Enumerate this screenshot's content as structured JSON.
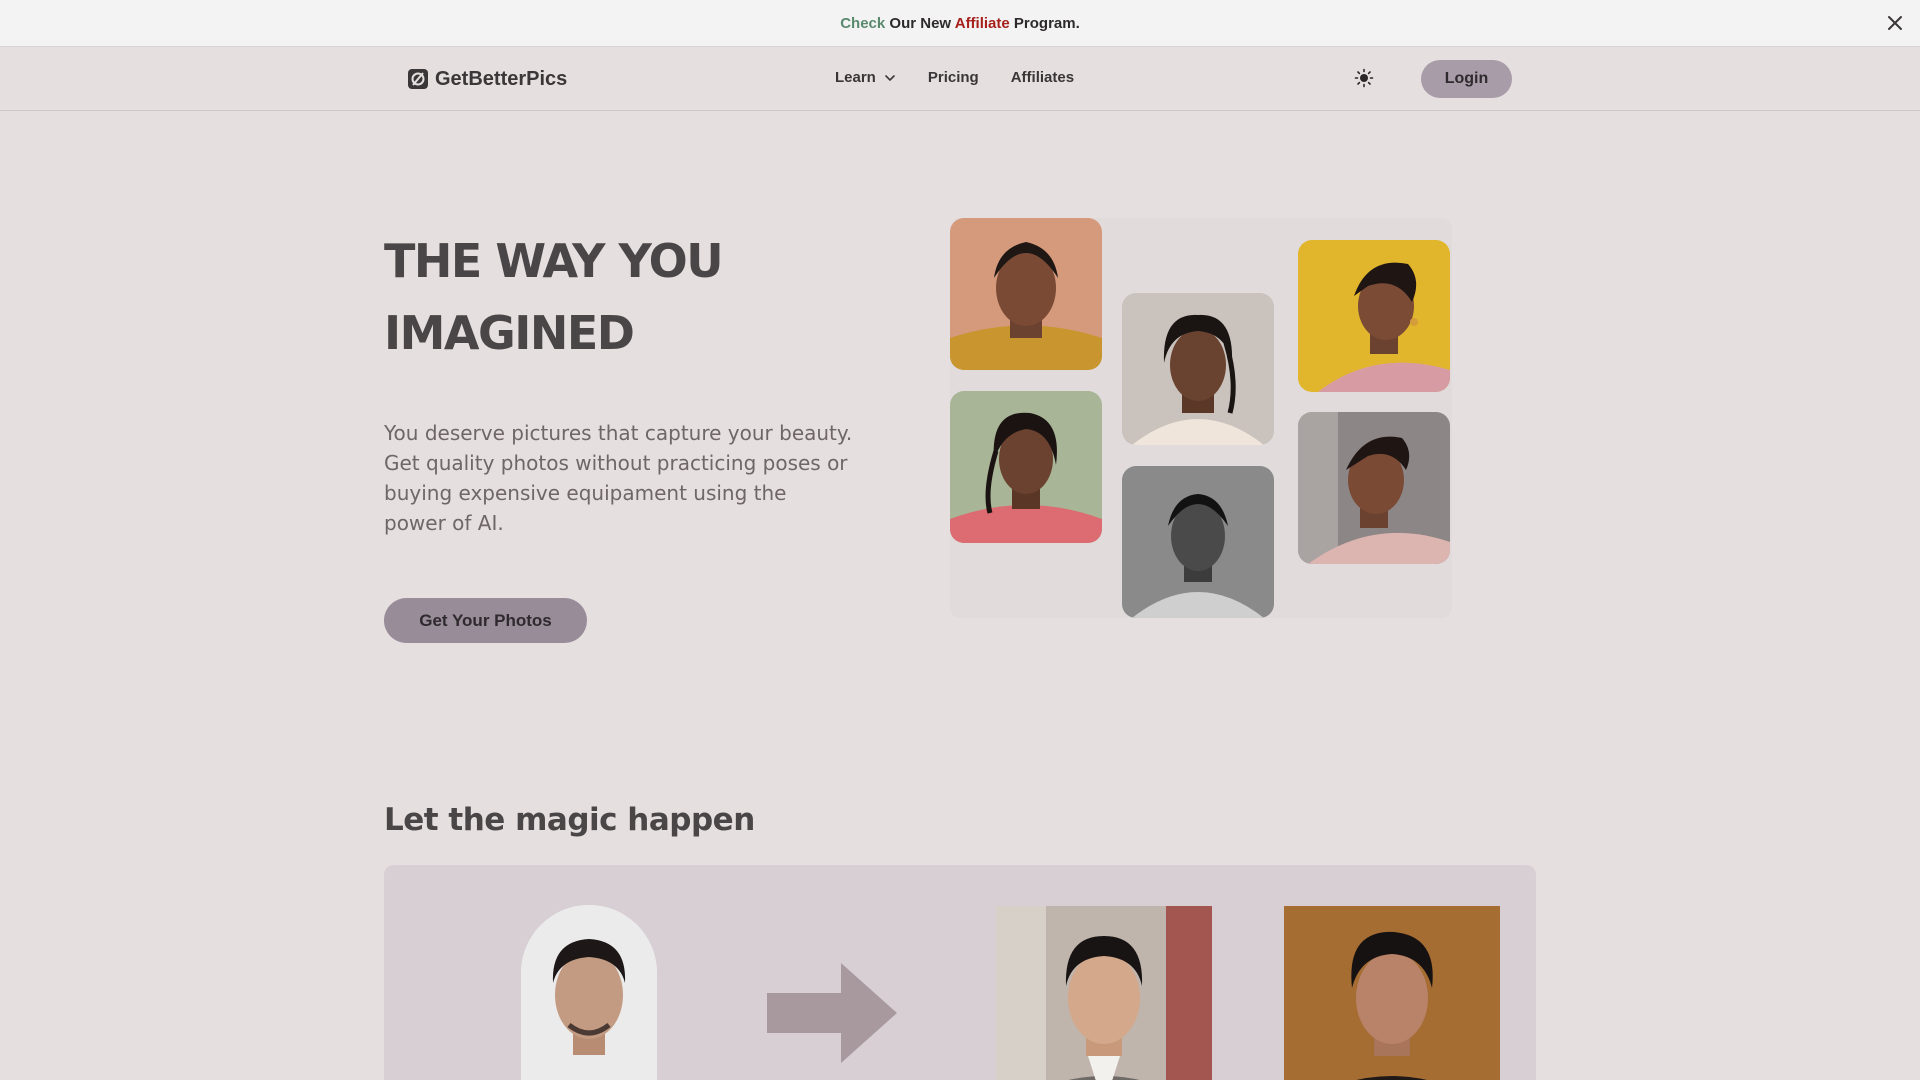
{
  "announcement": {
    "check": "Check",
    "middle": "Our New",
    "affiliate": "Affiliate",
    "end": "Program.",
    "close_icon": "close-icon"
  },
  "nav": {
    "brand": "GetBetterPics",
    "links": [
      {
        "label": "Learn",
        "has_dropdown": true
      },
      {
        "label": "Pricing"
      },
      {
        "label": "Affiliates"
      }
    ],
    "theme_icon": "sun-icon",
    "login_label": "Login"
  },
  "hero": {
    "title_line1": "THE WAY YOU",
    "title_line2": "IMAGINED",
    "subtitle": "You deserve pictures that capture your beauty. Get quality photos without practicing poses or buying expensive equipament using the power of AI.",
    "cta_label": "Get Your Photos"
  },
  "gallery": {
    "photos": [
      {
        "name": "portrait-woman-yellow-sweater"
      },
      {
        "name": "portrait-woman-beige-turtleneck"
      },
      {
        "name": "portrait-woman-pink-sweater-yellow-bg"
      },
      {
        "name": "portrait-woman-pink-sweater-green-bg"
      },
      {
        "name": "portrait-woman-black-and-white"
      },
      {
        "name": "portrait-woman-pink-sweater-street"
      }
    ]
  },
  "magic": {
    "title": "Let the magic happen",
    "arrow_icon": "right-arrow-icon"
  },
  "colors": {
    "background": "#e5dfe0",
    "button": "#978c98",
    "login": "#a79ca7",
    "check_accent": "#5a8a6e",
    "affiliate_accent": "#a7211c"
  }
}
